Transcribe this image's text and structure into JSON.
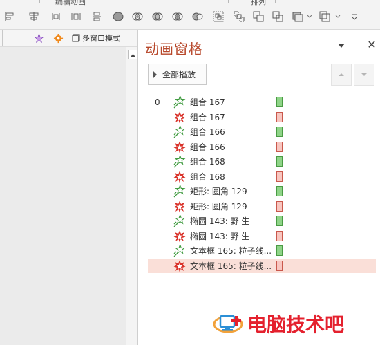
{
  "ribbon": {
    "cut_labels": [
      "编辑动画",
      "排列"
    ],
    "icons": [
      "align-left-edge-icon",
      "align-center-horizontal-icon",
      "align-right-edge-icon",
      "distribute-horizontal-icon",
      "distribute-vertical-icon",
      "shape-union-icon",
      "shape-combine-icon",
      "shape-fragment-icon",
      "shape-intersect-icon",
      "shape-subtract-icon",
      "group-icon",
      "ungroup-icon",
      "bring-forward-icon",
      "send-backward-icon",
      "selection-pane-icon",
      "rotate-icon",
      "ribbon-options-icon"
    ]
  },
  "left_toolbar": {
    "mode_label": "多窗口模式"
  },
  "pane": {
    "title": "动画窗格",
    "play_all_label": "全部播放",
    "close_glyph": "✕",
    "items": [
      {
        "number": "0",
        "name": "组合 167",
        "effect": "entrance",
        "selected": false
      },
      {
        "number": "",
        "name": "组合 167",
        "effect": "exit",
        "selected": false
      },
      {
        "number": "",
        "name": "组合 166",
        "effect": "entrance",
        "selected": false
      },
      {
        "number": "",
        "name": "组合 166",
        "effect": "exit",
        "selected": false
      },
      {
        "number": "",
        "name": "组合 168",
        "effect": "entrance",
        "selected": false
      },
      {
        "number": "",
        "name": "组合 168",
        "effect": "exit",
        "selected": false
      },
      {
        "number": "",
        "name": "矩形: 圆角 129",
        "effect": "entrance",
        "selected": false
      },
      {
        "number": "",
        "name": "矩形: 圆角 129",
        "effect": "exit",
        "selected": false
      },
      {
        "number": "",
        "name": "椭圆 143: 野  生",
        "effect": "entrance",
        "selected": false
      },
      {
        "number": "",
        "name": "椭圆 143: 野  生",
        "effect": "exit",
        "selected": false
      },
      {
        "number": "",
        "name": "文本框 165: 粒子线...",
        "effect": "entrance",
        "selected": false
      },
      {
        "number": "",
        "name": "文本框 165: 粒子线...",
        "effect": "exit",
        "selected": true
      }
    ]
  },
  "colors": {
    "title": "#b7472a",
    "entrance_star": "#3e9a3e",
    "exit_star": "#d9322a",
    "entrance_bar_fill": "#8fd488",
    "entrance_bar_border": "#4a9b44",
    "exit_bar_fill": "#f8c6c0",
    "exit_bar_border": "#c9584c",
    "selected_row": "#fadfd8",
    "watermark": "#e4212e"
  },
  "watermark": {
    "text": "电脑技术吧"
  }
}
